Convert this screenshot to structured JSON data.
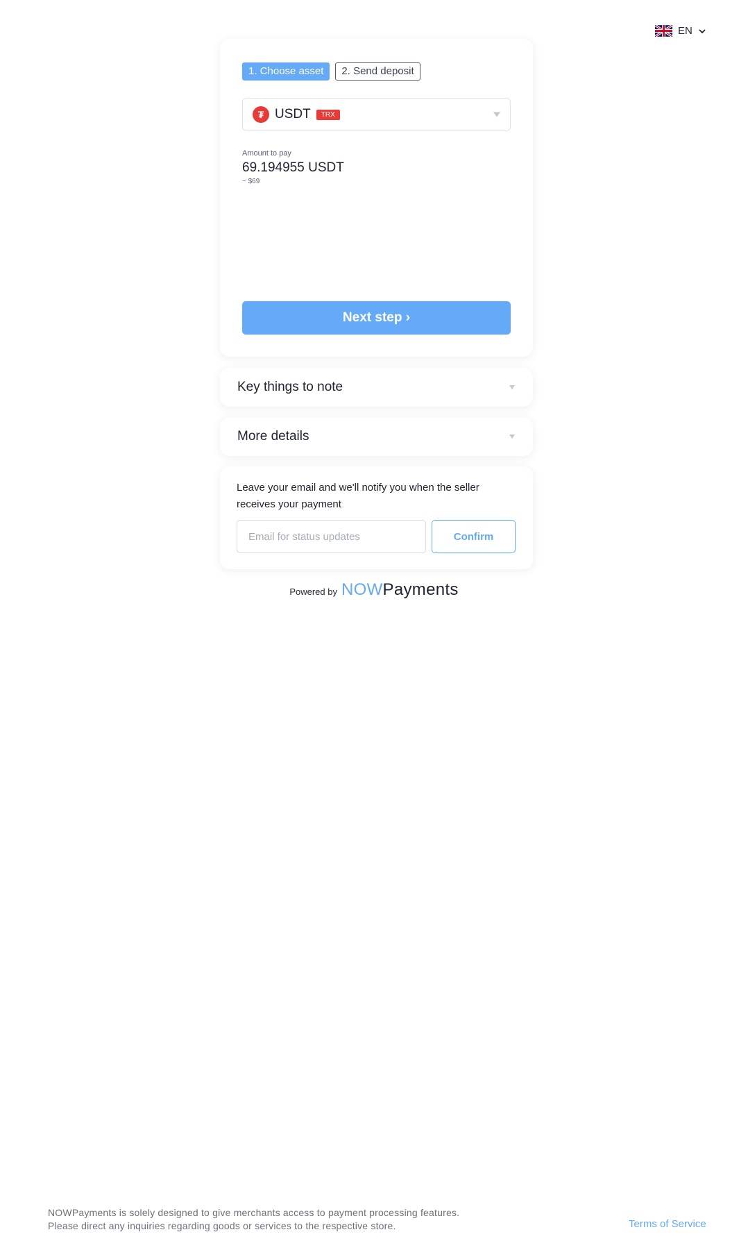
{
  "language": {
    "code": "EN",
    "flag": "uk-flag-icon"
  },
  "steps": [
    {
      "label": "1. Choose asset",
      "active": true
    },
    {
      "label": "2. Send deposit",
      "active": false
    }
  ],
  "asset": {
    "name": "USDT",
    "network": "TRX",
    "icon": "tether-icon",
    "color": "#e83a36"
  },
  "amount": {
    "label": "Amount to pay",
    "value": "69.194955 USDT",
    "fiat": "~ $69"
  },
  "next_button": "Next step ›",
  "accordions": [
    {
      "title": "Key things to note"
    },
    {
      "title": "More details"
    }
  ],
  "notify": {
    "line1": "Leave your email and we'll notify you when the seller",
    "line2": "receives your payment",
    "email_placeholder": "Email for status updates",
    "confirm_label": "Confirm"
  },
  "powered": {
    "prefix": "Powered by",
    "brand_now": "NOW",
    "brand_payments": "Payments"
  },
  "footer": {
    "line1": "NOWPayments is solely designed to give merchants access to payment processing features.",
    "line2": "Please direct any inquiries regarding goods or services to the respective store.",
    "terms": "Terms of Service"
  },
  "colors": {
    "accent": "#64aaf8",
    "tether": "#e83a36"
  }
}
